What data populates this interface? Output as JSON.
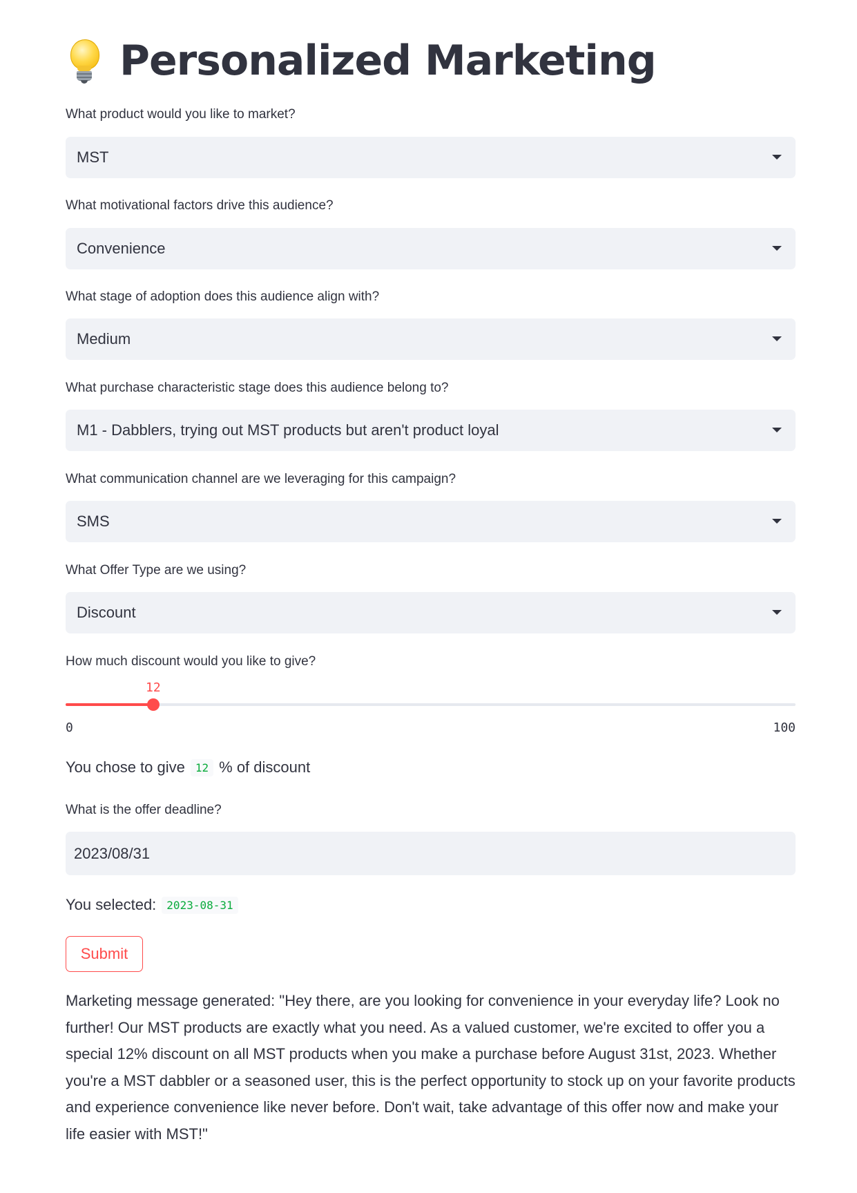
{
  "app": {
    "title": "Personalized Marketing",
    "title_icon": "light-bulb-icon"
  },
  "form": {
    "product": {
      "label": "What product would you like to market?",
      "value": "MST"
    },
    "motivation": {
      "label": "What motivational factors drive this audience?",
      "value": "Convenience"
    },
    "adoption_stage": {
      "label": "What stage of adoption does this audience align with?",
      "value": "Medium"
    },
    "purchase_stage": {
      "label": "What purchase characteristic stage does this audience belong to?",
      "value": "M1 - Dabblers, trying out MST products but aren't product loyal"
    },
    "channel": {
      "label": "What communication channel are we leveraging for this campaign?",
      "value": "SMS"
    },
    "offer_type": {
      "label": "What Offer Type are we using?",
      "value": "Discount"
    },
    "discount": {
      "label": "How much discount would you like to give?",
      "value": 12,
      "value_text": "12",
      "min": 0,
      "max": 100,
      "min_text": "0",
      "max_text": "100",
      "accent_color": "#ff4b4b"
    },
    "discount_summary": {
      "prefix": "You chose to give",
      "value": "12",
      "suffix": "% of discount"
    },
    "deadline": {
      "label": "What is the offer deadline?",
      "value": "2023/08/31"
    },
    "deadline_summary": {
      "prefix": "You selected:",
      "value": "2023-08-31"
    },
    "submit_label": "Submit"
  },
  "result": {
    "message": "Marketing message generated: \"Hey there, are you looking for convenience in your everyday life? Look no further! Our MST products are exactly what you need. As a valued customer, we're excited to offer you a special 12% discount on all MST products when you make a purchase before August 31st, 2023. Whether you're a MST dabbler or a seasoned user, this is the perfect opportunity to stock up on your favorite products and experience convenience like never before. Don't wait, take advantage of this offer now and make your life easier with MST!\""
  }
}
